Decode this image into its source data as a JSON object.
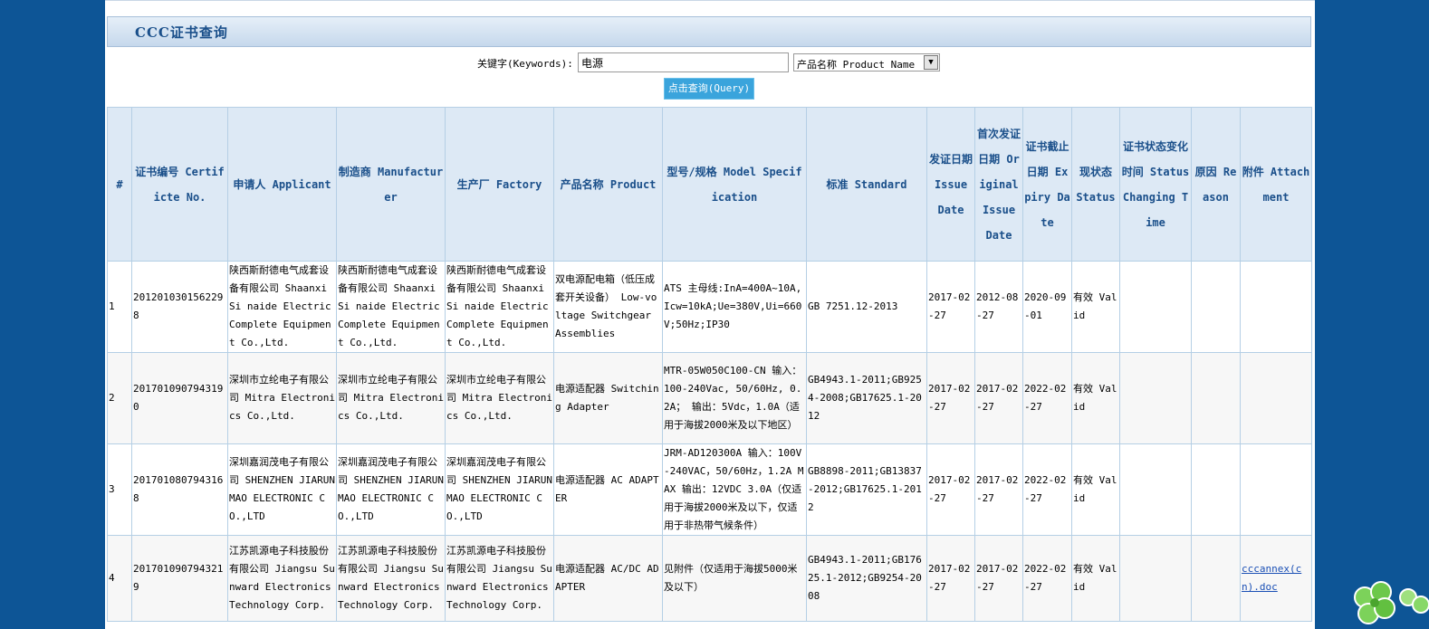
{
  "page": {
    "title": "CCC证书查询"
  },
  "search": {
    "keyword_label": "关键字(Keywords):",
    "keyword_value": "电源",
    "field_selected": "产品名称 Product Name",
    "query_button": "点击查询(Query)"
  },
  "table": {
    "headers": [
      "#",
      "证书编号 Certificte No.",
      "申请人 Applicant",
      "制造商 Manufacturer",
      "生产厂 Factory",
      "产品名称 Product",
      "型号/规格 Model Specification",
      "标准 Standard",
      "发证日期 Issue Date",
      "首次发证日期 Original Issue Date",
      "证书截止日期 Expiry Date",
      "现状态 Status",
      "证书状态变化时间 Status Changing Time",
      "原因 Reason",
      "附件 Attachment"
    ],
    "rows": [
      {
        "num": "1",
        "cert_no": "2012010301562298",
        "applicant": "陕西斯耐德电气成套设备有限公司 Shaanxi Si naide Electric Complete Equipment Co.,Ltd.",
        "manufacturer": "陕西斯耐德电气成套设备有限公司 Shaanxi Si naide Electric Complete Equipment Co.,Ltd.",
        "factory": "陕西斯耐德电气成套设备有限公司 Shaanxi Si naide Electric Complete Equipment Co.,Ltd.",
        "product": "双电源配电箱（低压成套开关设备） Low-voltage Switchgear Assemblies",
        "model": "ATS 主母线:InA=400A~10A,Icw=10kA;Ue=380V,Ui=660V;50Hz;IP30",
        "standard": "GB 7251.12-2013",
        "issue_date": "2017-02-27",
        "original_issue_date": "2012-08-27",
        "expiry_date": "2020-09-01",
        "status": "有效 Valid",
        "status_change": "",
        "reason": "",
        "attachment": ""
      },
      {
        "num": "2",
        "cert_no": "2017010907943190",
        "applicant": "深圳市立纶电子有限公司 Mitra Electronics Co.,Ltd.",
        "manufacturer": "深圳市立纶电子有限公司 Mitra Electronics Co.,Ltd.",
        "factory": "深圳市立纶电子有限公司 Mitra Electronics Co.,Ltd.",
        "product": "电源适配器 Switching Adapter",
        "model": "MTR-05W050C100-CN 输入：100-240Vac, 50/60Hz, 0.2A； 输出：5Vdc，1.0A（适用于海拔2000米及以下地区）",
        "standard": "GB4943.1-2011;GB9254-2008;GB17625.1-2012",
        "issue_date": "2017-02-27",
        "original_issue_date": "2017-02-27",
        "expiry_date": "2022-02-27",
        "status": "有效 Valid",
        "status_change": "",
        "reason": "",
        "attachment": ""
      },
      {
        "num": "3",
        "cert_no": "2017010807943168",
        "applicant": "深圳嘉润茂电子有限公司 SHENZHEN JIARUNMAO ELECTRONIC CO.,LTD",
        "manufacturer": "深圳嘉润茂电子有限公司 SHENZHEN JIARUNMAO ELECTRONIC CO.,LTD",
        "factory": "深圳嘉润茂电子有限公司 SHENZHEN JIARUNMAO ELECTRONIC CO.,LTD",
        "product": "电源适配器 AC ADAPTER",
        "model": "JRM-AD120300A 输入：100V-240VAC，50/60Hz，1.2A MAX 输出：12VDC 3.0A（仅适用于海拔2000米及以下，仅适用于非热带气候条件）",
        "standard": "GB8898-2011;GB13837-2012;GB17625.1-2012",
        "issue_date": "2017-02-27",
        "original_issue_date": "2017-02-27",
        "expiry_date": "2022-02-27",
        "status": "有效 Valid",
        "status_change": "",
        "reason": "",
        "attachment": ""
      },
      {
        "num": "4",
        "cert_no": "2017010907943219",
        "applicant": "江苏凯源电子科技股份有限公司 Jiangsu Sunward Electronics Technology Corp.",
        "manufacturer": "江苏凯源电子科技股份有限公司 Jiangsu Sunward Electronics Technology Corp.",
        "factory": "江苏凯源电子科技股份有限公司 Jiangsu Sunward Electronics Technology Corp.",
        "product": "电源适配器 AC/DC ADAPTER",
        "model": "见附件（仅适用于海拔5000米及以下）",
        "standard": "GB4943.1-2011;GB17625.1-2012;GB9254-2008",
        "issue_date": "2017-02-27",
        "original_issue_date": "2017-02-27",
        "expiry_date": "2022-02-27",
        "status": "有效 Valid",
        "status_change": "",
        "reason": "",
        "attachment": "cccannex(cn).doc"
      }
    ]
  },
  "colors": {
    "background": "#0d5596",
    "header_text": "#1a4f8a",
    "button": "#3aa4dc"
  },
  "icons": {
    "corner": "clover-icon"
  }
}
